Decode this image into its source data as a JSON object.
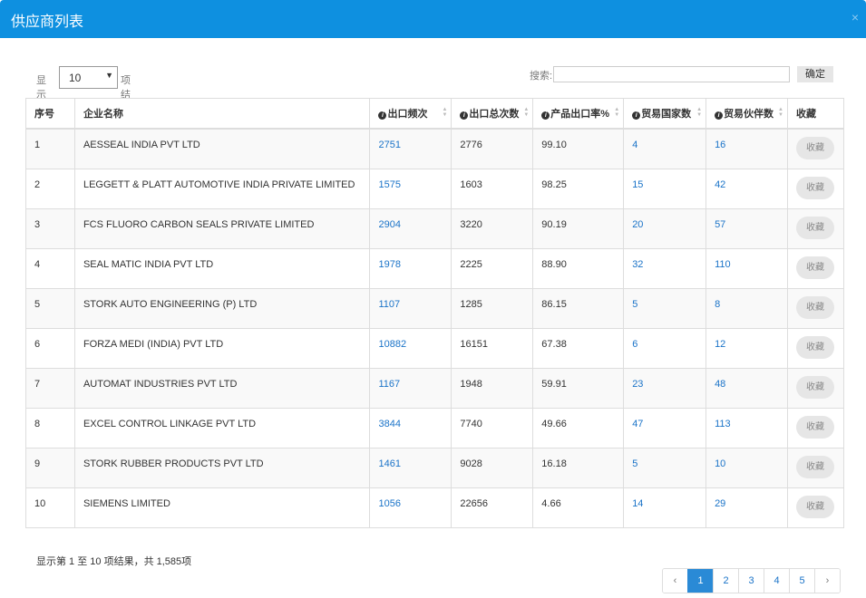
{
  "modal": {
    "title": "供应商列表",
    "close": "×"
  },
  "length": {
    "prefix": "显示",
    "value": "10",
    "suffix": "项结果"
  },
  "search": {
    "label": "搜索:",
    "value": "",
    "button": "确定"
  },
  "table": {
    "columns": [
      "序号",
      "企业名称",
      "出口频次",
      "出口总次数",
      "产品出口率%",
      "贸易国家数",
      "贸易伙伴数",
      "收藏"
    ],
    "favorite_label": "收藏",
    "rows": [
      {
        "no": "1",
        "name": "AESSEAL INDIA PVT LTD",
        "freq": "2751",
        "total": "2776",
        "rate": "99.10",
        "countries": "4",
        "partners": "16"
      },
      {
        "no": "2",
        "name": "LEGGETT & PLATT AUTOMOTIVE INDIA PRIVATE LIMITED",
        "freq": "1575",
        "total": "1603",
        "rate": "98.25",
        "countries": "15",
        "partners": "42"
      },
      {
        "no": "3",
        "name": "FCS FLUORO CARBON SEALS PRIVATE LIMITED",
        "freq": "2904",
        "total": "3220",
        "rate": "90.19",
        "countries": "20",
        "partners": "57"
      },
      {
        "no": "4",
        "name": "SEAL MATIC INDIA PVT LTD",
        "freq": "1978",
        "total": "2225",
        "rate": "88.90",
        "countries": "32",
        "partners": "110"
      },
      {
        "no": "5",
        "name": "STORK AUTO ENGINEERING (P) LTD",
        "freq": "1107",
        "total": "1285",
        "rate": "86.15",
        "countries": "5",
        "partners": "8"
      },
      {
        "no": "6",
        "name": "FORZA MEDI (INDIA) PVT LTD",
        "freq": "10882",
        "total": "16151",
        "rate": "67.38",
        "countries": "6",
        "partners": "12"
      },
      {
        "no": "7",
        "name": "AUTOMAT INDUSTRIES PVT LTD",
        "freq": "1167",
        "total": "1948",
        "rate": "59.91",
        "countries": "23",
        "partners": "48"
      },
      {
        "no": "8",
        "name": "EXCEL CONTROL LINKAGE PVT LTD",
        "freq": "3844",
        "total": "7740",
        "rate": "49.66",
        "countries": "47",
        "partners": "113"
      },
      {
        "no": "9",
        "name": "STORK RUBBER PRODUCTS PVT LTD",
        "freq": "1461",
        "total": "9028",
        "rate": "16.18",
        "countries": "5",
        "partners": "10"
      },
      {
        "no": "10",
        "name": "SIEMENS LIMITED",
        "freq": "1056",
        "total": "22656",
        "rate": "4.66",
        "countries": "14",
        "partners": "29"
      }
    ]
  },
  "info": "显示第 1 至 10 项结果，共 1,585项",
  "pagination": {
    "prev": "‹",
    "pages": [
      "1",
      "2",
      "3",
      "4",
      "5"
    ],
    "next": "›",
    "active": "1"
  },
  "colors": {
    "header": "#0e90e0",
    "link": "#1a73c8",
    "active_page": "#2a8ad6"
  }
}
